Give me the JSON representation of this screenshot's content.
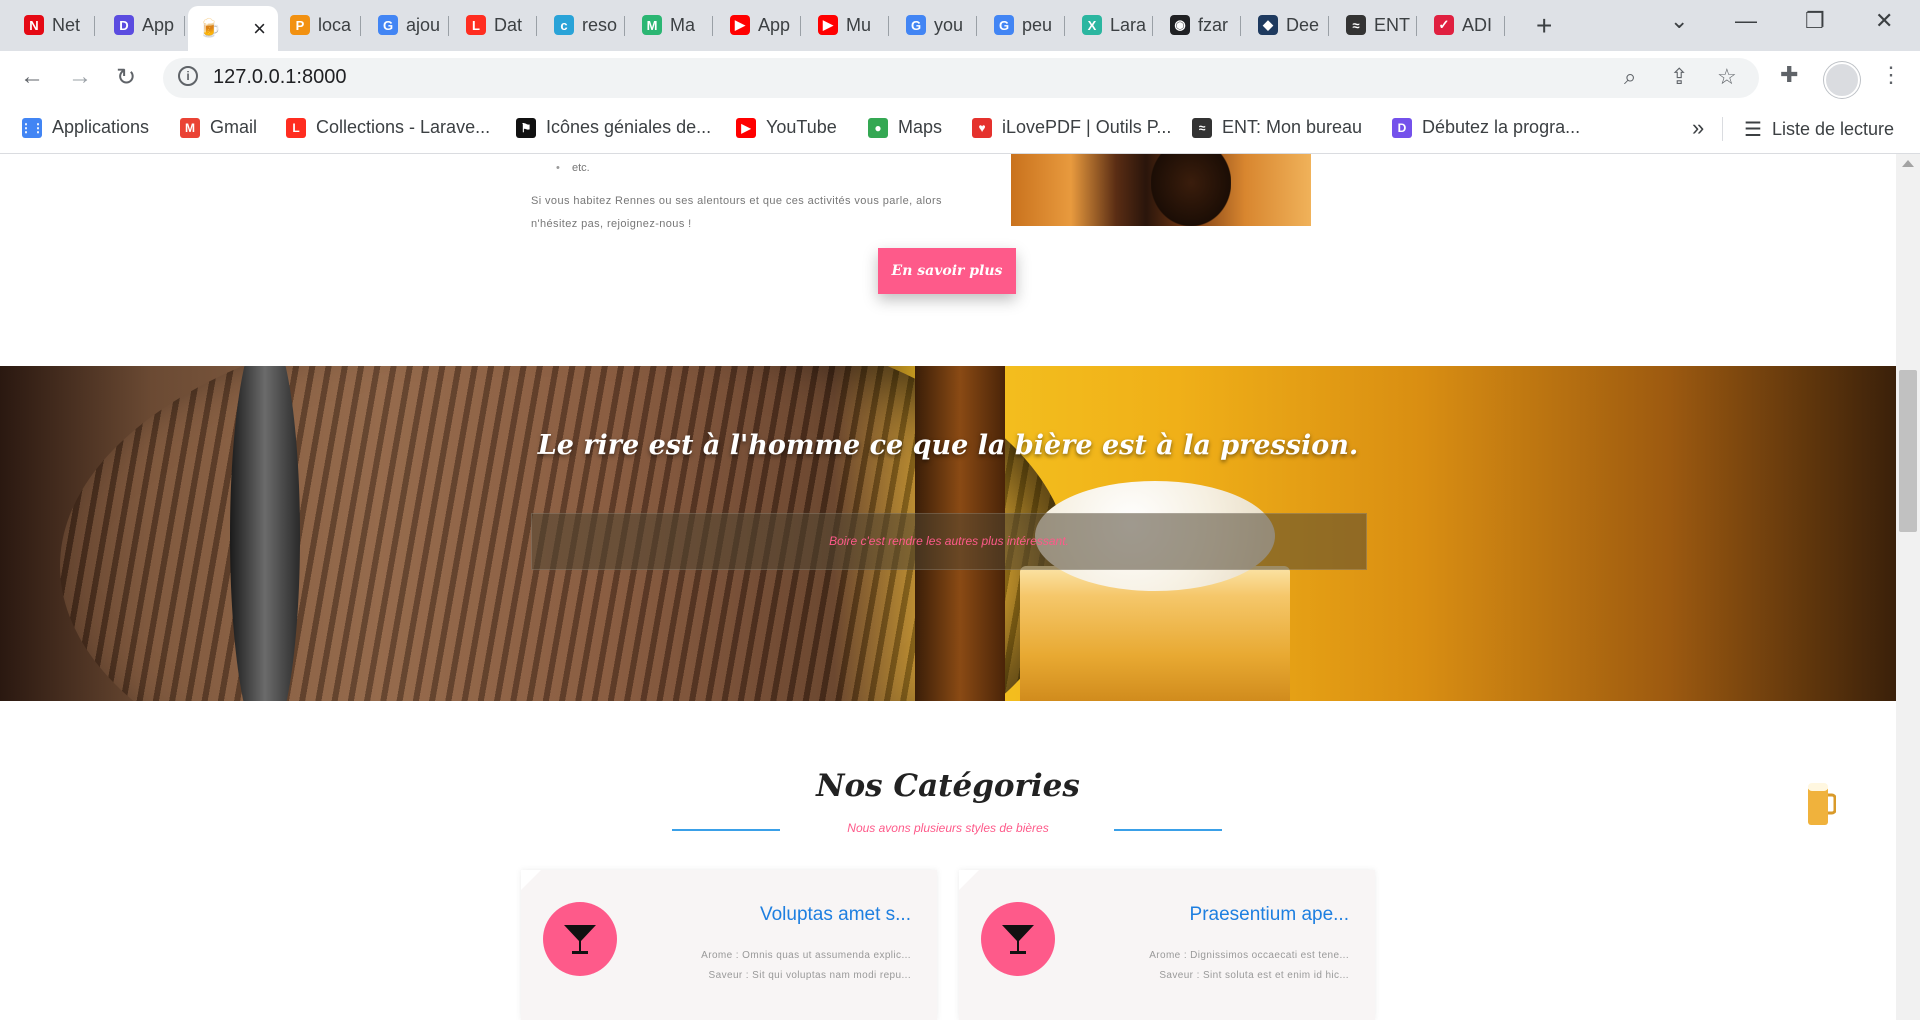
{
  "tabs": [
    {
      "label": "Net",
      "fav": "N",
      "color": "#e50914",
      "icon": "netflix-icon"
    },
    {
      "label": "App",
      "fav": "D",
      "color": "#5b4ce0",
      "icon": "app-icon"
    },
    {
      "label": "",
      "fav": "🍺",
      "color": "#ffffff",
      "icon": "beer-tab-icon",
      "active": true
    },
    {
      "label": "loca",
      "fav": "P",
      "color": "#f29111",
      "icon": "phpmyadmin-icon"
    },
    {
      "label": "ajou",
      "fav": "G",
      "color": "#4285f4",
      "icon": "google-icon"
    },
    {
      "label": "Dat",
      "fav": "L",
      "color": "#ff2d20",
      "icon": "laravel-icon"
    },
    {
      "label": "reso",
      "fav": "c",
      "color": "#29a3d8",
      "icon": "res-icon"
    },
    {
      "label": "Ma",
      "fav": "M",
      "color": "#2bb673",
      "icon": "malt-icon"
    },
    {
      "label": "App",
      "fav": "▶",
      "color": "#ff0000",
      "icon": "youtube-icon"
    },
    {
      "label": "Mu",
      "fav": "▶",
      "color": "#ff0000",
      "icon": "youtube-icon"
    },
    {
      "label": "you",
      "fav": "G",
      "color": "#4285f4",
      "icon": "google-icon"
    },
    {
      "label": "peu",
      "fav": "G",
      "color": "#4285f4",
      "icon": "google-icon"
    },
    {
      "label": "Lara",
      "fav": "X",
      "color": "#2bb6a0",
      "icon": "laracasts-icon"
    },
    {
      "label": "fzar",
      "fav": "◉",
      "color": "#202124",
      "icon": "github-icon"
    },
    {
      "label": "Dee",
      "fav": "◆",
      "color": "#1e3a5f",
      "icon": "deepl-icon"
    },
    {
      "label": "ENT",
      "fav": "≈",
      "color": "#333333",
      "icon": "ent-icon"
    },
    {
      "label": "ADI",
      "fav": "✓",
      "color": "#e02040",
      "icon": "adi-icon"
    }
  ],
  "address": {
    "url": "127.0.0.1:8000"
  },
  "bookmarks": [
    {
      "label": "Applications",
      "icon": "apps-grid-icon",
      "color": "#4285f4",
      "fav": "⋮⋮"
    },
    {
      "label": "Gmail",
      "icon": "gmail-icon",
      "color": "#ea4335",
      "fav": "M"
    },
    {
      "label": "Collections - Larave...",
      "icon": "laravel-icon",
      "color": "#ff2d20",
      "fav": "L"
    },
    {
      "label": "Icônes géniales de...",
      "icon": "fontawesome-icon",
      "color": "#111111",
      "fav": "⚑"
    },
    {
      "label": "YouTube",
      "icon": "youtube-icon",
      "color": "#ff0000",
      "fav": "▶"
    },
    {
      "label": "Maps",
      "icon": "maps-icon",
      "color": "#34a853",
      "fav": "●"
    },
    {
      "label": "iLovePDF | Outils P...",
      "icon": "ilovepdf-icon",
      "color": "#e5322d",
      "fav": "♥"
    },
    {
      "label": "ENT: Mon bureau",
      "icon": "ent-icon",
      "color": "#333333",
      "fav": "≈"
    },
    {
      "label": "Débutez la progra...",
      "icon": "openclassrooms-icon",
      "color": "#7451eb",
      "fav": "D"
    }
  ],
  "reading_list": "Liste de lecture",
  "page": {
    "about_list_item": "etc.",
    "about_text": "Si vous habitez Rennes ou ses alentours et que ces activités vous parle, alors n'hésitez pas, rejoignez-nous !",
    "cta": "En savoir plus",
    "hero_title": "Le rire est à l'homme ce que la bière est à la pression.",
    "hero_subtitle": "Boire c'est rendre les autres plus intéressant.",
    "categories_title": "Nos Catégories",
    "categories_subtitle": "Nous avons plusieurs styles de bières",
    "cards": [
      {
        "title": "Voluptas amet s...",
        "arome": "Arome : Omnis quas ut assumenda explic...",
        "saveur": "Saveur : Sit qui voluptas nam modi repu..."
      },
      {
        "title": "Praesentium ape...",
        "arome": "Arome : Dignissimos occaecati est tene...",
        "saveur": "Saveur : Sint soluta est et enim id hic..."
      }
    ]
  },
  "colors": {
    "accent": "#fe5a8a",
    "link": "#1e7fe0",
    "line": "#3aa0e8"
  }
}
